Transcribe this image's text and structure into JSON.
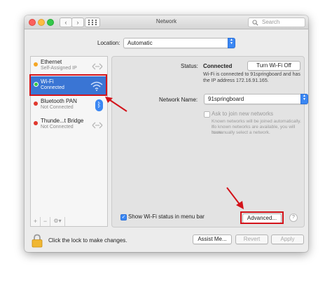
{
  "window": {
    "title": "Network"
  },
  "toolbar": {
    "back": "‹",
    "forward": "›",
    "search_placeholder": "Search"
  },
  "location": {
    "label": "Location:",
    "value": "Automatic"
  },
  "services": [
    {
      "name": "Ethernet",
      "status": "Self-Assigned IP",
      "dot": "#f5a623"
    },
    {
      "name": "Wi-Fi",
      "status": "Connected",
      "dot": "#35c649"
    },
    {
      "name": "Bluetooth PAN",
      "status": "Not Connected",
      "dot": "#e0382e"
    },
    {
      "name": "Thunde...t Bridge",
      "status": "Not Connected",
      "dot": "#e0382e"
    }
  ],
  "sidebar_controls": {
    "add": "+",
    "remove": "−",
    "gear": "⚙︎▾"
  },
  "status": {
    "label": "Status:",
    "value": "Connected",
    "toggle_button": "Turn Wi-Fi Off",
    "description_line1": "Wi-Fi is connected to 91springboard and has",
    "description_line2": "the IP address 172.16.91.165."
  },
  "network_name": {
    "label": "Network Name:",
    "value": "91springboard"
  },
  "ask_join": {
    "label": "Ask to join new networks",
    "checked": false,
    "help_line1": "Known networks will be joined automatically. If",
    "help_line2": "no known networks are available, you will have",
    "help_line3": "to manually select a network."
  },
  "show_status": {
    "label": "Show Wi-Fi status in menu bar",
    "checked": true
  },
  "advanced_button": "Advanced...",
  "help_button": "?",
  "footer": {
    "lock_text": "Click the lock to make changes.",
    "assist_button": "Assist Me...",
    "revert_button": "Revert",
    "apply_button": "Apply"
  },
  "colors": {
    "highlight": "#d3131a",
    "selection": "#3a75d4",
    "accent": "#3b87f3"
  }
}
